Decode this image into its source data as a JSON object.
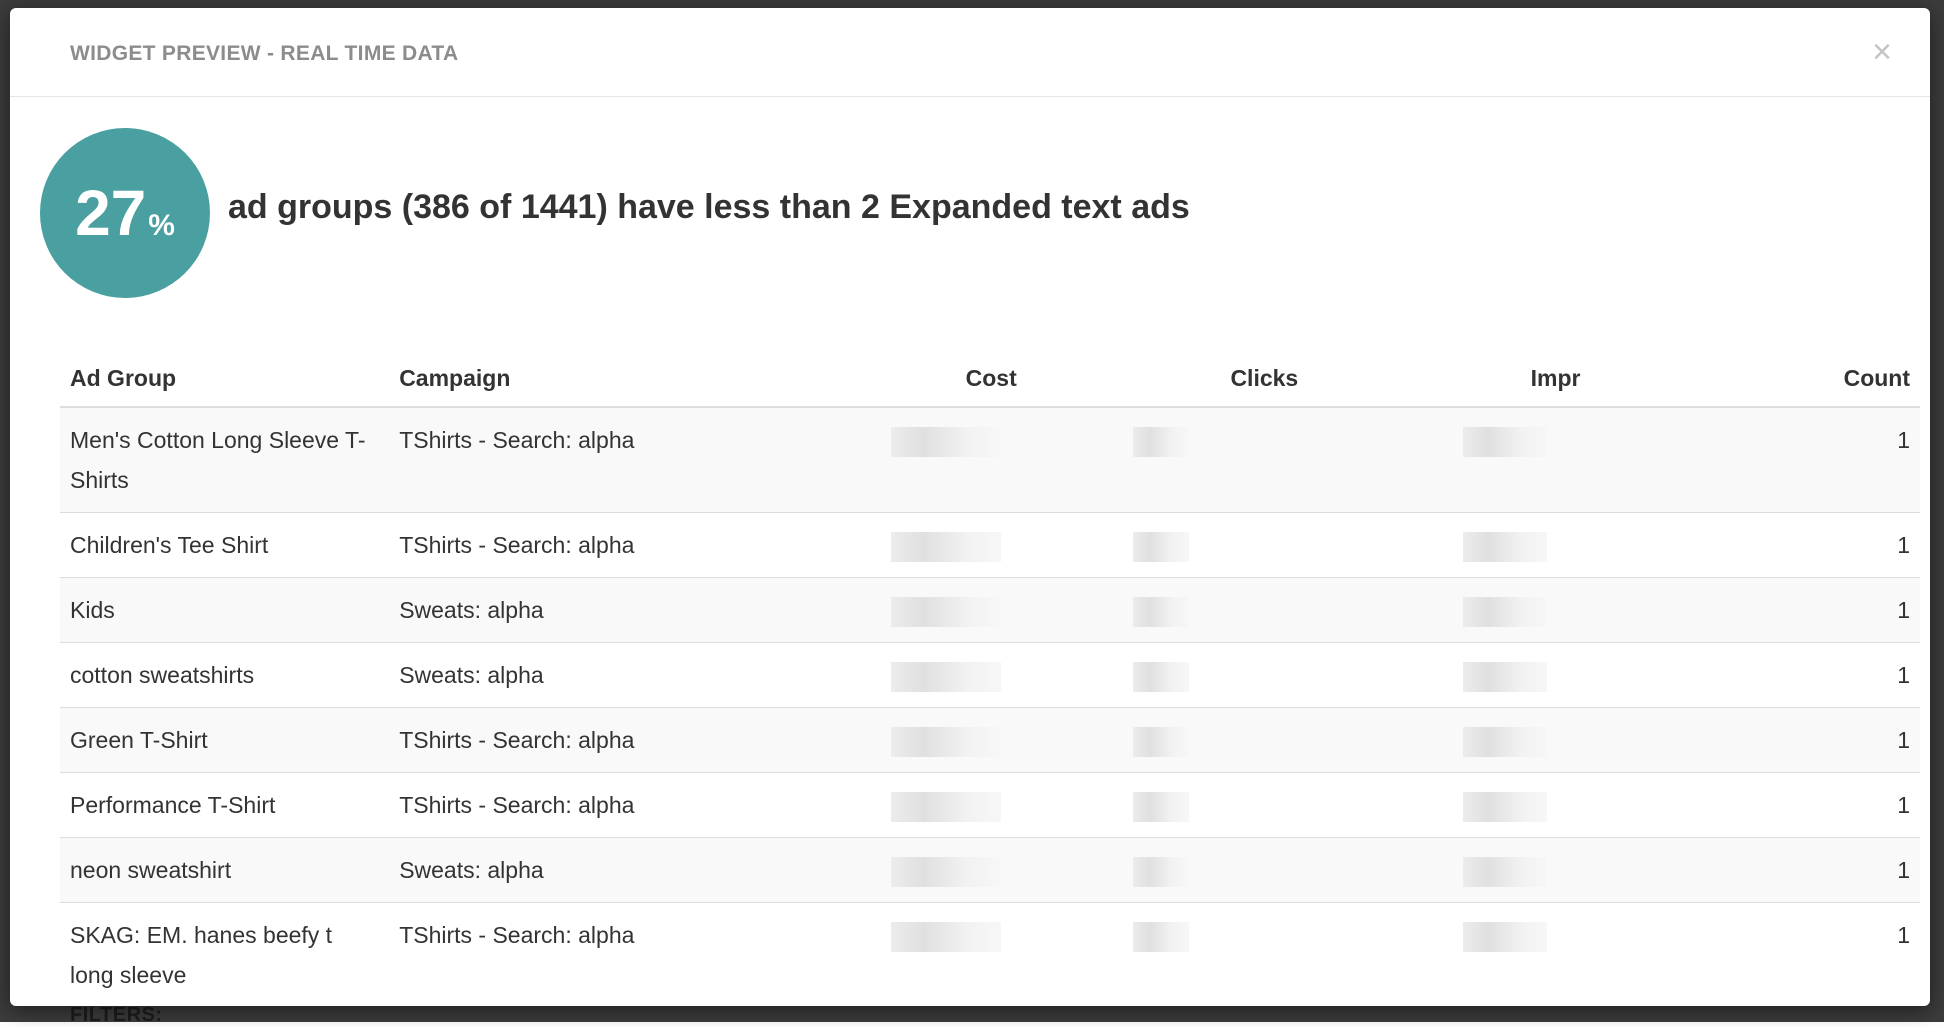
{
  "modal": {
    "title": "WIDGET PREVIEW - REAL TIME DATA",
    "close_glyph": "×",
    "close_icon": "close-icon"
  },
  "background": {
    "behind_label": "FILTERS:"
  },
  "summary": {
    "percent": "27",
    "percent_unit": "%",
    "headline": "ad groups (386 of 1441) have less than 2 Expanded text ads",
    "circle_color": "#4a9fa0"
  },
  "table": {
    "columns": {
      "ad_group": "Ad Group",
      "campaign": "Campaign",
      "cost": "Cost",
      "clicks": "Clicks",
      "impr": "Impr",
      "count": "Count"
    },
    "rows": [
      {
        "ad_group": "Men's Cotton Long Sleeve T-Shirts",
        "campaign": "TShirts - Search: alpha",
        "count": "1"
      },
      {
        "ad_group": "Children's Tee Shirt",
        "campaign": "TShirts - Search: alpha",
        "count": "1"
      },
      {
        "ad_group": "Kids",
        "campaign": "Sweats: alpha",
        "count": "1"
      },
      {
        "ad_group": "cotton sweatshirts",
        "campaign": "Sweats: alpha",
        "count": "1"
      },
      {
        "ad_group": "Green T-Shirt",
        "campaign": "TShirts - Search: alpha",
        "count": "1"
      },
      {
        "ad_group": "Performance T-Shirt",
        "campaign": "TShirts - Search: alpha",
        "count": "1"
      },
      {
        "ad_group": "neon sweatshirt",
        "campaign": "Sweats: alpha",
        "count": "1"
      },
      {
        "ad_group": "SKAG: EM. hanes beefy t long sleeve",
        "campaign": "TShirts - Search: alpha",
        "count": "1"
      }
    ]
  }
}
